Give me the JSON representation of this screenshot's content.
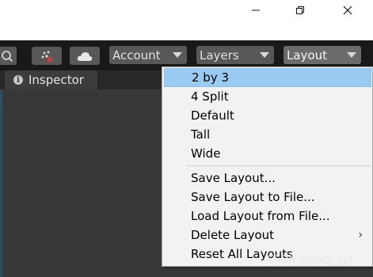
{
  "toolbar": {
    "account_label": "Account",
    "layers_label": "Layers",
    "layout_label": "Layout"
  },
  "tab": {
    "label": "Inspector"
  },
  "menu": {
    "items": [
      {
        "label": "2 by 3"
      },
      {
        "label": "4 Split"
      },
      {
        "label": "Default"
      },
      {
        "label": "Tall"
      },
      {
        "label": "Wide"
      },
      {
        "label": "Save Layout..."
      },
      {
        "label": "Save Layout to File..."
      },
      {
        "label": "Load Layout from File..."
      },
      {
        "label": "Delete Layout"
      },
      {
        "label": "Reset All Layouts"
      }
    ]
  },
  "watermark": "CSDN @buct_zpf",
  "colors": {
    "selection": "#99cbf2",
    "toolbar_bg": "#191919",
    "menu_bg": "#f2f2f2"
  }
}
